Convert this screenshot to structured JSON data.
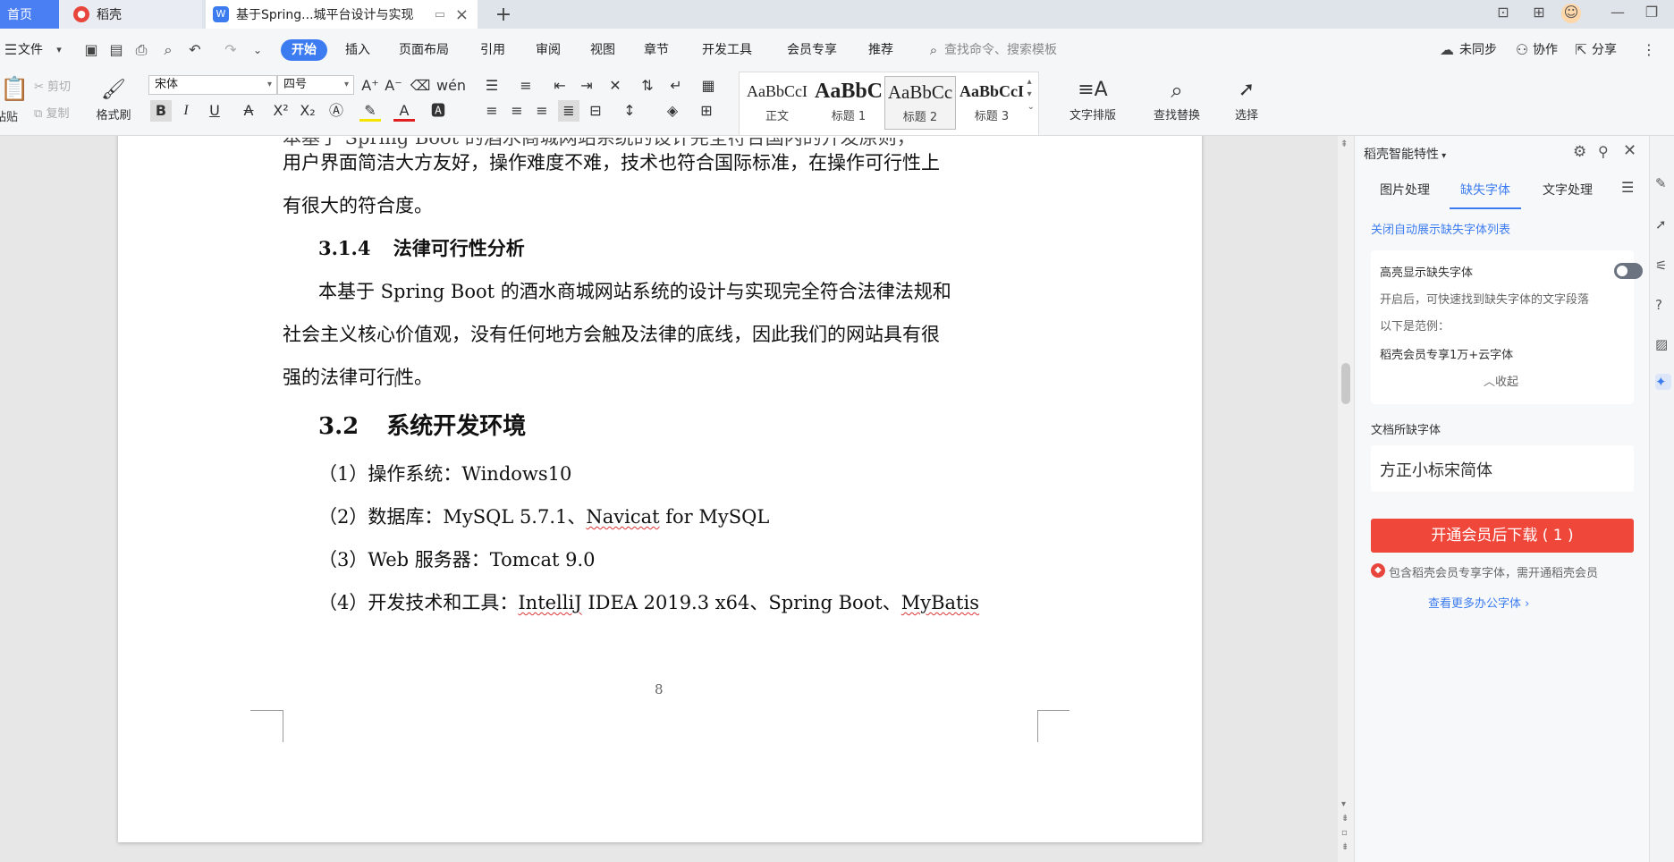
{
  "tabs": {
    "home": "首页",
    "daoke": "稻壳",
    "doc": "基于Spring...城平台设计与实现"
  },
  "menu": {
    "file": "文件",
    "start": "开始",
    "insert": "插入",
    "layout": "页面布局",
    "reference": "引用",
    "review": "审阅",
    "view": "视图",
    "chapter": "章节",
    "devtools": "开发工具",
    "member": "会员专享",
    "recommend": "推荐",
    "search_placeholder": "查找命令、搜索模板",
    "unsynced": "未同步",
    "collab": "协作",
    "share": "分享"
  },
  "ribbon": {
    "paste": "粘贴",
    "cut": "剪切",
    "copy": "复制",
    "format_painter": "格式刷",
    "font_name": "宋体",
    "font_size": "四号",
    "styles": [
      {
        "preview": "AaBbCcI",
        "name": "正文"
      },
      {
        "preview": "AaBbC",
        "name": "标题 1"
      },
      {
        "preview": "AaBbCc",
        "name": "标题 2"
      },
      {
        "preview": "AaBbCcI",
        "name": "标题 3"
      }
    ],
    "text_layout": "文字排版",
    "find_replace": "查找替换",
    "select": "选择"
  },
  "document": {
    "line_partial": "本基于 Spring Boot 的酒水商城网站系统的设计完全符合国内的开发原则，",
    "line1": "用户界面简洁大方友好，操作难度不难，技术也符合国际标准，在操作可行性上",
    "line2": "有很大的符合度。",
    "heading_314_num": "3.1.4",
    "heading_314_title": "法律可行性分析",
    "para1_l1": "本基于 Spring Boot 的酒水商城网站系统的设计与实现完全符合法律法规和",
    "para1_l2": "社会主义核心价值观，没有任何地方会触及法律的底线，因此我们的网站具有很",
    "para1_l3": "强的法律可行性。",
    "heading_32_num": "3.2",
    "heading_32_title": "系统开发环境",
    "item1": "（1）操作系统：Windows10",
    "item2_a": "（2）数据库：MySQL 5.7.1、",
    "item2_b": "Navicat",
    "item2_c": " for MySQL",
    "item3": "（3）Web 服务器：Tomcat 9.0",
    "item4_a": "（4）开发技术和工具：",
    "item4_b": "IntelliJ",
    "item4_c": " IDEA 2019.3 x64、Spring Boot、",
    "item4_d": "MyBatis",
    "page_number": "8"
  },
  "panel": {
    "title": "稻壳智能特性",
    "tab_image": "图片处理",
    "tab_missing_font": "缺失字体",
    "tab_text": "文字处理",
    "close_auto_list": "关闭自动展示缺失字体列表",
    "highlight_title": "高亮显示缺失字体",
    "highlight_desc": "开启后，可快速找到缺失字体的文字段落",
    "example_label": "以下是范例：",
    "example_text": "稻壳会员专享1万+云字体",
    "collapse": "收起",
    "doc_missing_fonts": "文档所缺字体",
    "missing_font_name": "方正小标宋简体",
    "download_button": "开通会员后下载 ( 1 )",
    "member_note": "包含稻壳会员专享字体，需开通稻壳会员",
    "more_fonts": "查看更多办公字体"
  },
  "colors": {
    "accent": "#3c7cf0",
    "download": "#f0473b",
    "link": "#3c7cf0"
  }
}
